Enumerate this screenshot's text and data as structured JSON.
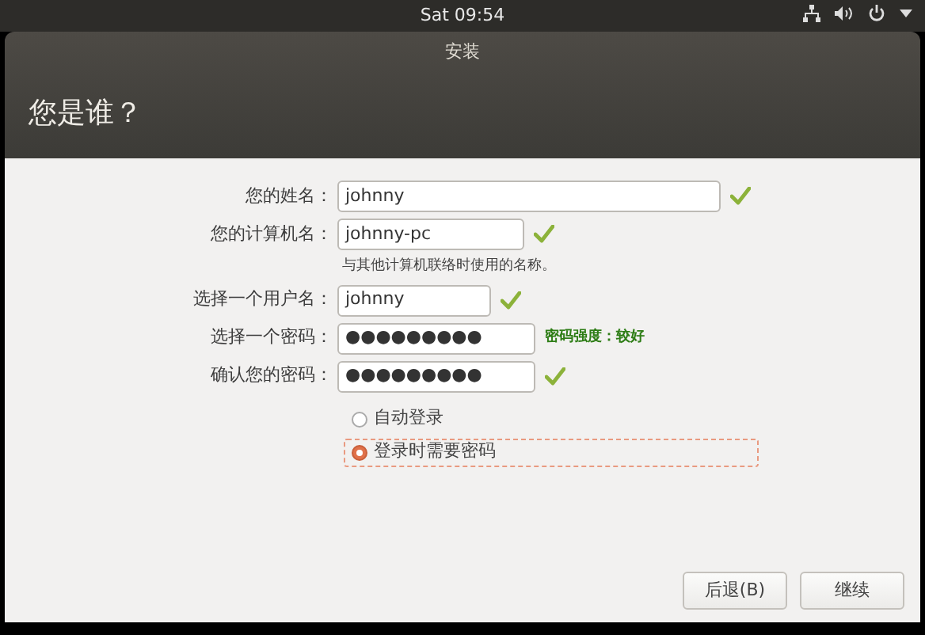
{
  "top_bar": {
    "clock": "Sat 09:54"
  },
  "window": {
    "title": "安装",
    "heading": "您是谁？"
  },
  "fields": [
    {
      "label": "您的姓名：",
      "value": "johnny",
      "valid": true
    },
    {
      "label": "您的计算机名：",
      "value": "johnny-pc",
      "valid": true,
      "hint": "与其他计算机联络时使用的名称。"
    },
    {
      "label": "选择一个用户名：",
      "value": "johnny",
      "valid": true
    },
    {
      "label": "选择一个密码：",
      "value": "●●●●●●●●●",
      "valid": false,
      "strength": "密码强度：较好"
    },
    {
      "label": "确认您的密码：",
      "value": "●●●●●●●●●",
      "valid": true
    }
  ],
  "login_options": [
    {
      "label": "自动登录",
      "selected": false
    },
    {
      "label": "登录时需要密码",
      "selected": true
    }
  ],
  "buttons": [
    "后退(B)",
    "继续"
  ]
}
